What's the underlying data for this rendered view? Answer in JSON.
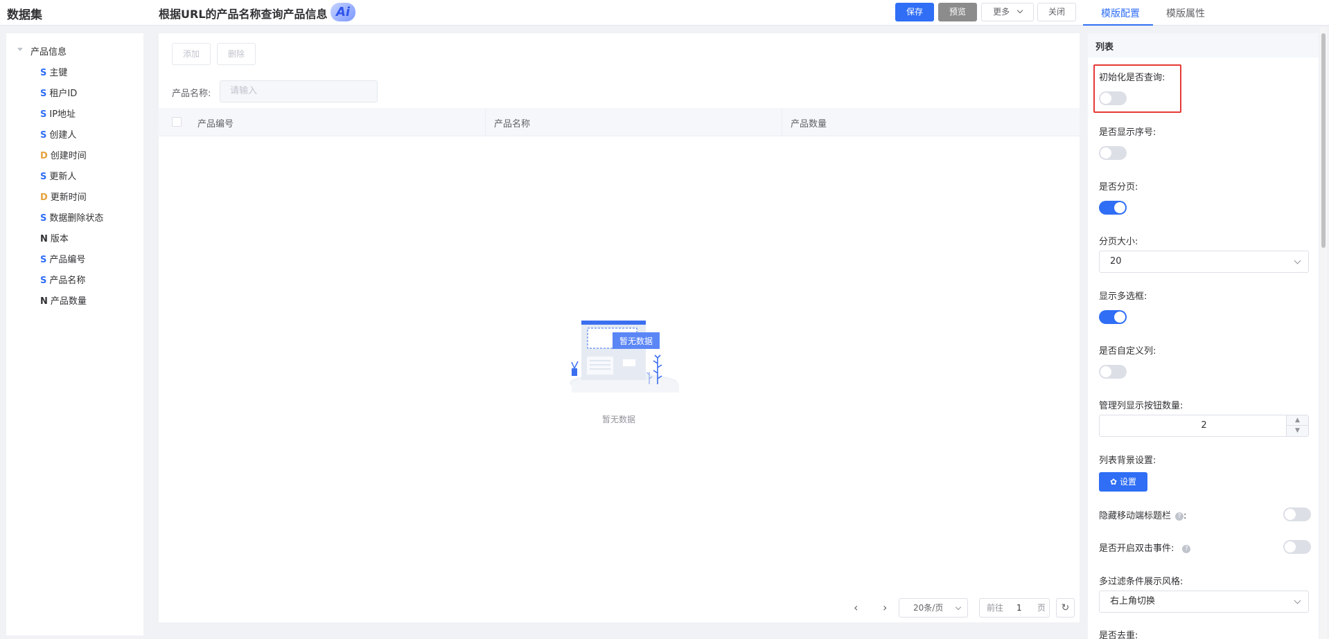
{
  "header": {
    "dataset_title": "数据集",
    "page_title": "根据URL的产品名称查询产品信息",
    "ai_badge": "Ai",
    "save": "保存",
    "preview": "预览",
    "more": "更多",
    "close": "关闭"
  },
  "right_tabs": [
    "模版配置",
    "模版属性"
  ],
  "tree": {
    "root": "产品信息",
    "items": [
      {
        "type": "S",
        "label": "主键"
      },
      {
        "type": "S",
        "label": "租户ID"
      },
      {
        "type": "S",
        "label": "IP地址"
      },
      {
        "type": "S",
        "label": "创建人"
      },
      {
        "type": "D",
        "label": "创建时间"
      },
      {
        "type": "S",
        "label": "更新人"
      },
      {
        "type": "D",
        "label": "更新时间"
      },
      {
        "type": "S",
        "label": "数据删除状态"
      },
      {
        "type": "N",
        "label": "版本"
      },
      {
        "type": "S",
        "label": "产品编号"
      },
      {
        "type": "S",
        "label": "产品名称"
      },
      {
        "type": "N",
        "label": "产品数量"
      }
    ]
  },
  "toolbar": {
    "add": "添加",
    "delete": "删除"
  },
  "filter": {
    "label": "产品名称:",
    "placeholder": "请输入"
  },
  "table": {
    "columns": [
      "产品编号",
      "产品名称",
      "产品数量"
    ],
    "empty_illustration_text": "暂无数据",
    "empty_text": "暂无数据"
  },
  "pagination": {
    "page_size": "20条/页",
    "goto_prefix": "前往",
    "goto_value": "1",
    "goto_suffix": "页"
  },
  "config": {
    "section_title": "列表",
    "init_query": {
      "label": "初始化是否查询:",
      "on": false
    },
    "show_index": {
      "label": "是否显示序号:",
      "on": false
    },
    "paging": {
      "label": "是否分页:",
      "on": true
    },
    "page_size": {
      "label": "分页大小:",
      "value": "20"
    },
    "multi_select": {
      "label": "显示多选框:",
      "on": true
    },
    "custom_columns": {
      "label": "是否自定义列:",
      "on": false
    },
    "manage_buttons": {
      "label": "管理列显示按钮数量:",
      "value": "2"
    },
    "bg_setting": {
      "label": "列表背景设置:",
      "button": "设置"
    },
    "hide_mobile_title": {
      "label": "隐藏移动端标题栏",
      "on": false
    },
    "dblclick": {
      "label": "是否开启双击事件:",
      "on": false
    },
    "filter_style": {
      "label": "多过滤条件展示风格:",
      "value": "右上角切换"
    },
    "dedupe": {
      "label": "是否去重:"
    }
  },
  "colors": {
    "primary": "#2f6ef5",
    "highlight": "#e53935"
  }
}
